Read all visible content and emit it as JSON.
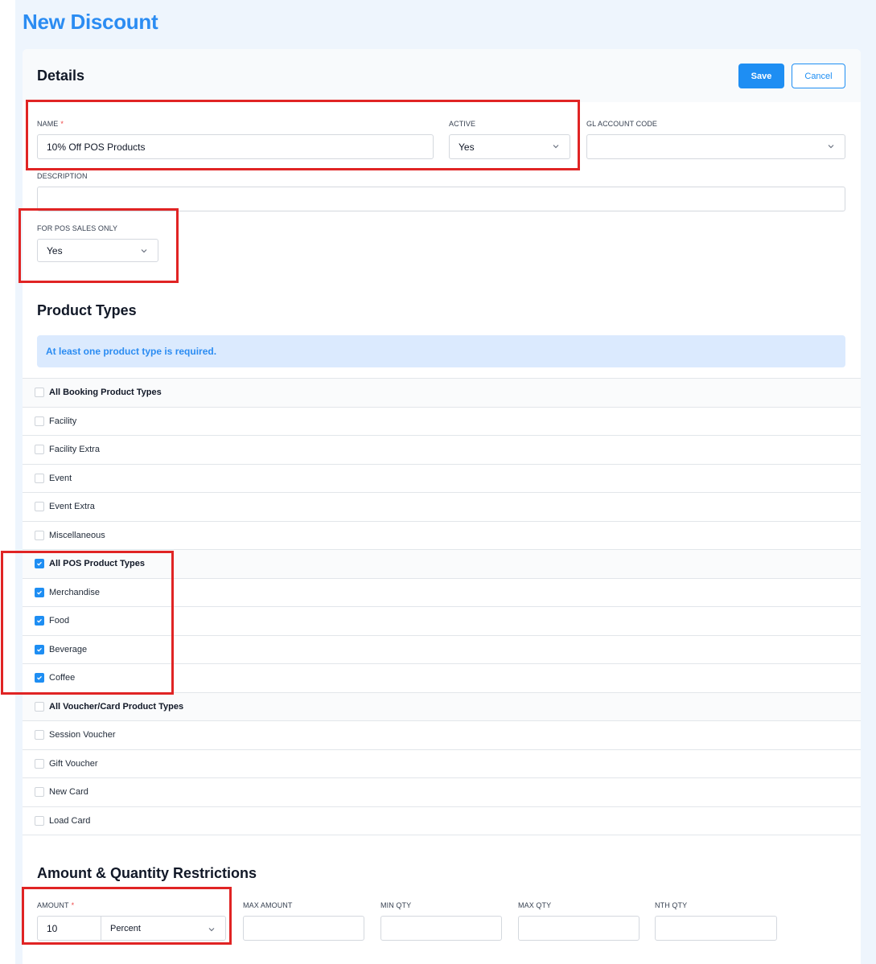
{
  "page": {
    "title": "New Discount"
  },
  "details": {
    "title": "Details",
    "save_label": "Save",
    "cancel_label": "Cancel",
    "name": {
      "label": "NAME",
      "required_mark": "*",
      "value": "10% Off POS Products"
    },
    "active": {
      "label": "ACTIVE",
      "value": "Yes"
    },
    "gl_account": {
      "label": "GL ACCOUNT CODE",
      "value": ""
    },
    "description": {
      "label": "DESCRIPTION",
      "value": ""
    },
    "pos_only": {
      "label": "FOR POS SALES ONLY",
      "value": "Yes"
    }
  },
  "product_types": {
    "title": "Product Types",
    "notice": "At least one product type is required.",
    "items": [
      {
        "label": "All Booking Product Types",
        "group": true,
        "checked": false
      },
      {
        "label": "Facility",
        "group": false,
        "checked": false
      },
      {
        "label": "Facility Extra",
        "group": false,
        "checked": false
      },
      {
        "label": "Event",
        "group": false,
        "checked": false
      },
      {
        "label": "Event Extra",
        "group": false,
        "checked": false
      },
      {
        "label": "Miscellaneous",
        "group": false,
        "checked": false
      },
      {
        "label": "All POS Product Types",
        "group": true,
        "checked": true
      },
      {
        "label": "Merchandise",
        "group": false,
        "checked": true
      },
      {
        "label": "Food",
        "group": false,
        "checked": true
      },
      {
        "label": "Beverage",
        "group": false,
        "checked": true
      },
      {
        "label": "Coffee",
        "group": false,
        "checked": true
      },
      {
        "label": "All Voucher/Card Product Types",
        "group": true,
        "checked": false
      },
      {
        "label": "Session Voucher",
        "group": false,
        "checked": false
      },
      {
        "label": "Gift Voucher",
        "group": false,
        "checked": false
      },
      {
        "label": "New Card",
        "group": false,
        "checked": false
      },
      {
        "label": "Load Card",
        "group": false,
        "checked": false
      }
    ]
  },
  "restrictions": {
    "title": "Amount & Quantity Restrictions",
    "amount": {
      "label": "AMOUNT",
      "required_mark": "*",
      "value": "10",
      "unit": "Percent"
    },
    "max_amount": {
      "label": "MAX AMOUNT",
      "value": ""
    },
    "min_qty": {
      "label": "MIN QTY",
      "value": ""
    },
    "max_qty": {
      "label": "MAX QTY",
      "value": ""
    },
    "nth_qty": {
      "label": "NTH QTY",
      "value": ""
    }
  },
  "colors": {
    "accent": "#1e8ef3",
    "title": "#2b8cf2",
    "highlight": "#e02424",
    "page_bg": "#eef5fd"
  }
}
